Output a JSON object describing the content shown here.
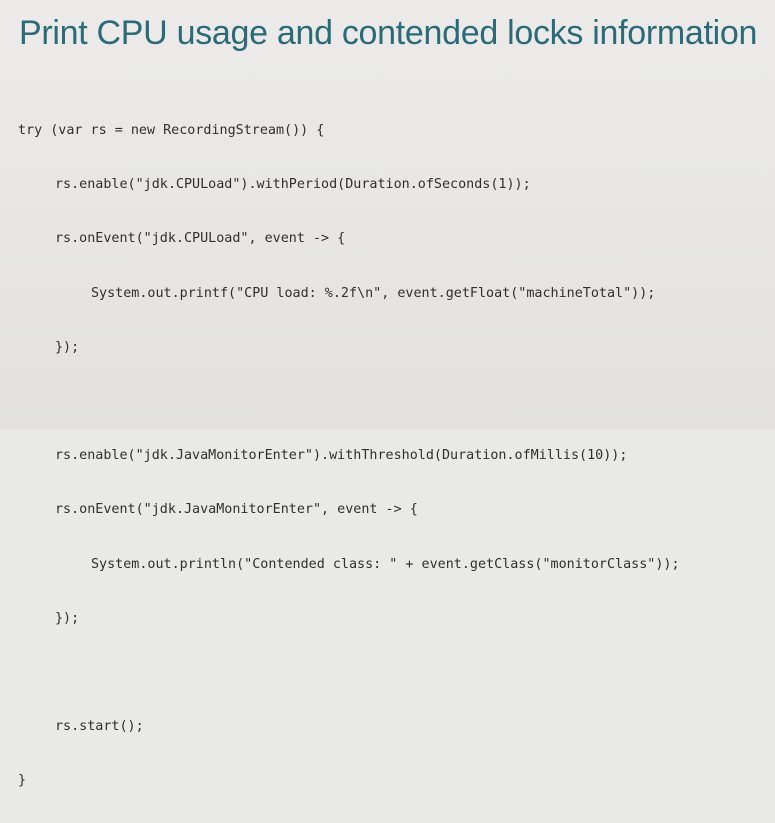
{
  "slide": {
    "title": "Print CPU usage and contended locks information"
  },
  "code": {
    "lines": [
      "try (var rs = new RecordingStream()) {",
      "rs.enable(\"jdk.CPULoad\").withPeriod(Duration.ofSeconds(1));",
      "rs.onEvent(\"jdk.CPULoad\", event -> {",
      "System.out.printf(\"CPU load: %.2f\\n\", event.getFloat(\"machineTotal\"));",
      "});",
      "",
      "rs.enable(\"jdk.JavaMonitorEnter\").withThreshold(Duration.ofMillis(10));",
      "rs.onEvent(\"jdk.JavaMonitorEnter\", event -> {",
      "System.out.println(\"Contended class: \" + event.getClass(\"monitorClass\"));",
      "});",
      "",
      "rs.start();",
      "}"
    ]
  }
}
